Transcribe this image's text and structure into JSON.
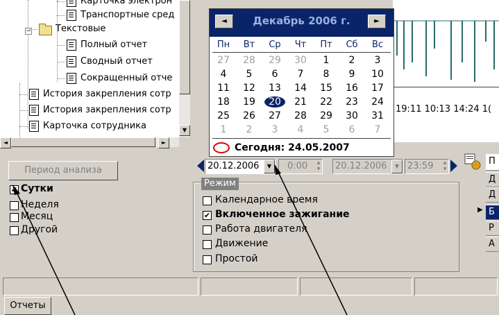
{
  "tree": {
    "items": [
      {
        "label": "Карточка электрон",
        "type": "doc"
      },
      {
        "label": "Транспортные сред",
        "type": "doc"
      },
      {
        "label": "Текстовые",
        "type": "folder"
      },
      {
        "label": "Полный отчет",
        "type": "doc"
      },
      {
        "label": "Сводный отчет",
        "type": "doc"
      },
      {
        "label": "Сокращенный отче",
        "type": "doc"
      },
      {
        "label": "История закрепления сотр",
        "type": "doc"
      },
      {
        "label": "История закрепления сотр",
        "type": "doc"
      },
      {
        "label": "Карточка сотрудника",
        "type": "doc"
      }
    ]
  },
  "left_panel": {
    "period_button": "Период анализа",
    "options": [
      {
        "label": "Сутки",
        "checked": true,
        "bold": true
      },
      {
        "label": "Неделя",
        "checked": false
      },
      {
        "label": "Месяц",
        "checked": false
      },
      {
        "label": "Другой",
        "checked": false
      }
    ]
  },
  "calendar": {
    "title": "Декабрь 2006 г.",
    "prev": "◄",
    "next": "►",
    "weekdays": [
      "Пн",
      "Вт",
      "Ср",
      "Чт",
      "Пт",
      "Сб",
      "Вс"
    ],
    "weeks": [
      [
        {
          "d": "27",
          "o": true
        },
        {
          "d": "28",
          "o": true
        },
        {
          "d": "29",
          "o": true
        },
        {
          "d": "30",
          "o": true
        },
        {
          "d": "1"
        },
        {
          "d": "2"
        },
        {
          "d": "3"
        }
      ],
      [
        {
          "d": "4"
        },
        {
          "d": "5"
        },
        {
          "d": "6"
        },
        {
          "d": "7"
        },
        {
          "d": "8"
        },
        {
          "d": "9"
        },
        {
          "d": "10"
        }
      ],
      [
        {
          "d": "11"
        },
        {
          "d": "12"
        },
        {
          "d": "13"
        },
        {
          "d": "14"
        },
        {
          "d": "15"
        },
        {
          "d": "16"
        },
        {
          "d": "17"
        }
      ],
      [
        {
          "d": "18"
        },
        {
          "d": "19"
        },
        {
          "d": "20",
          "sel": true
        },
        {
          "d": "21"
        },
        {
          "d": "22"
        },
        {
          "d": "23"
        },
        {
          "d": "24"
        }
      ],
      [
        {
          "d": "25"
        },
        {
          "d": "26"
        },
        {
          "d": "27"
        },
        {
          "d": "28"
        },
        {
          "d": "29"
        },
        {
          "d": "30"
        },
        {
          "d": "31"
        }
      ],
      [
        {
          "d": "1",
          "o": true
        },
        {
          "d": "2",
          "o": true
        },
        {
          "d": "3",
          "o": true
        },
        {
          "d": "4",
          "o": true
        },
        {
          "d": "5",
          "o": true
        },
        {
          "d": "6",
          "o": true
        },
        {
          "d": "7",
          "o": true
        }
      ]
    ],
    "today": "Сегодня: 24.05.2007"
  },
  "chart": {
    "time_labels": "19:11 10:13 14:24 1("
  },
  "date_range": {
    "from_date": "20.12.2006",
    "from_time": "0:00",
    "to_date": "20.12.2006",
    "to_time": "23:59"
  },
  "mode": {
    "label": "Режим",
    "options": [
      {
        "label": "Календарное время",
        "checked": false
      },
      {
        "label": "Включенное зажигание",
        "checked": true,
        "bold": true
      },
      {
        "label": "Работа двигателя",
        "checked": false
      },
      {
        "label": "Движение",
        "checked": false
      },
      {
        "label": "Простой",
        "checked": false
      }
    ]
  },
  "right_list": {
    "header": "П",
    "items": [
      "Д",
      "Д",
      "Б",
      "Р",
      "А"
    ],
    "selected_index": 2
  },
  "tabs": {
    "reports": "Отчеты"
  },
  "colors": {
    "calendar_header": "#0a246a",
    "selection": "#0a246a",
    "today_circle": "#e00000"
  }
}
